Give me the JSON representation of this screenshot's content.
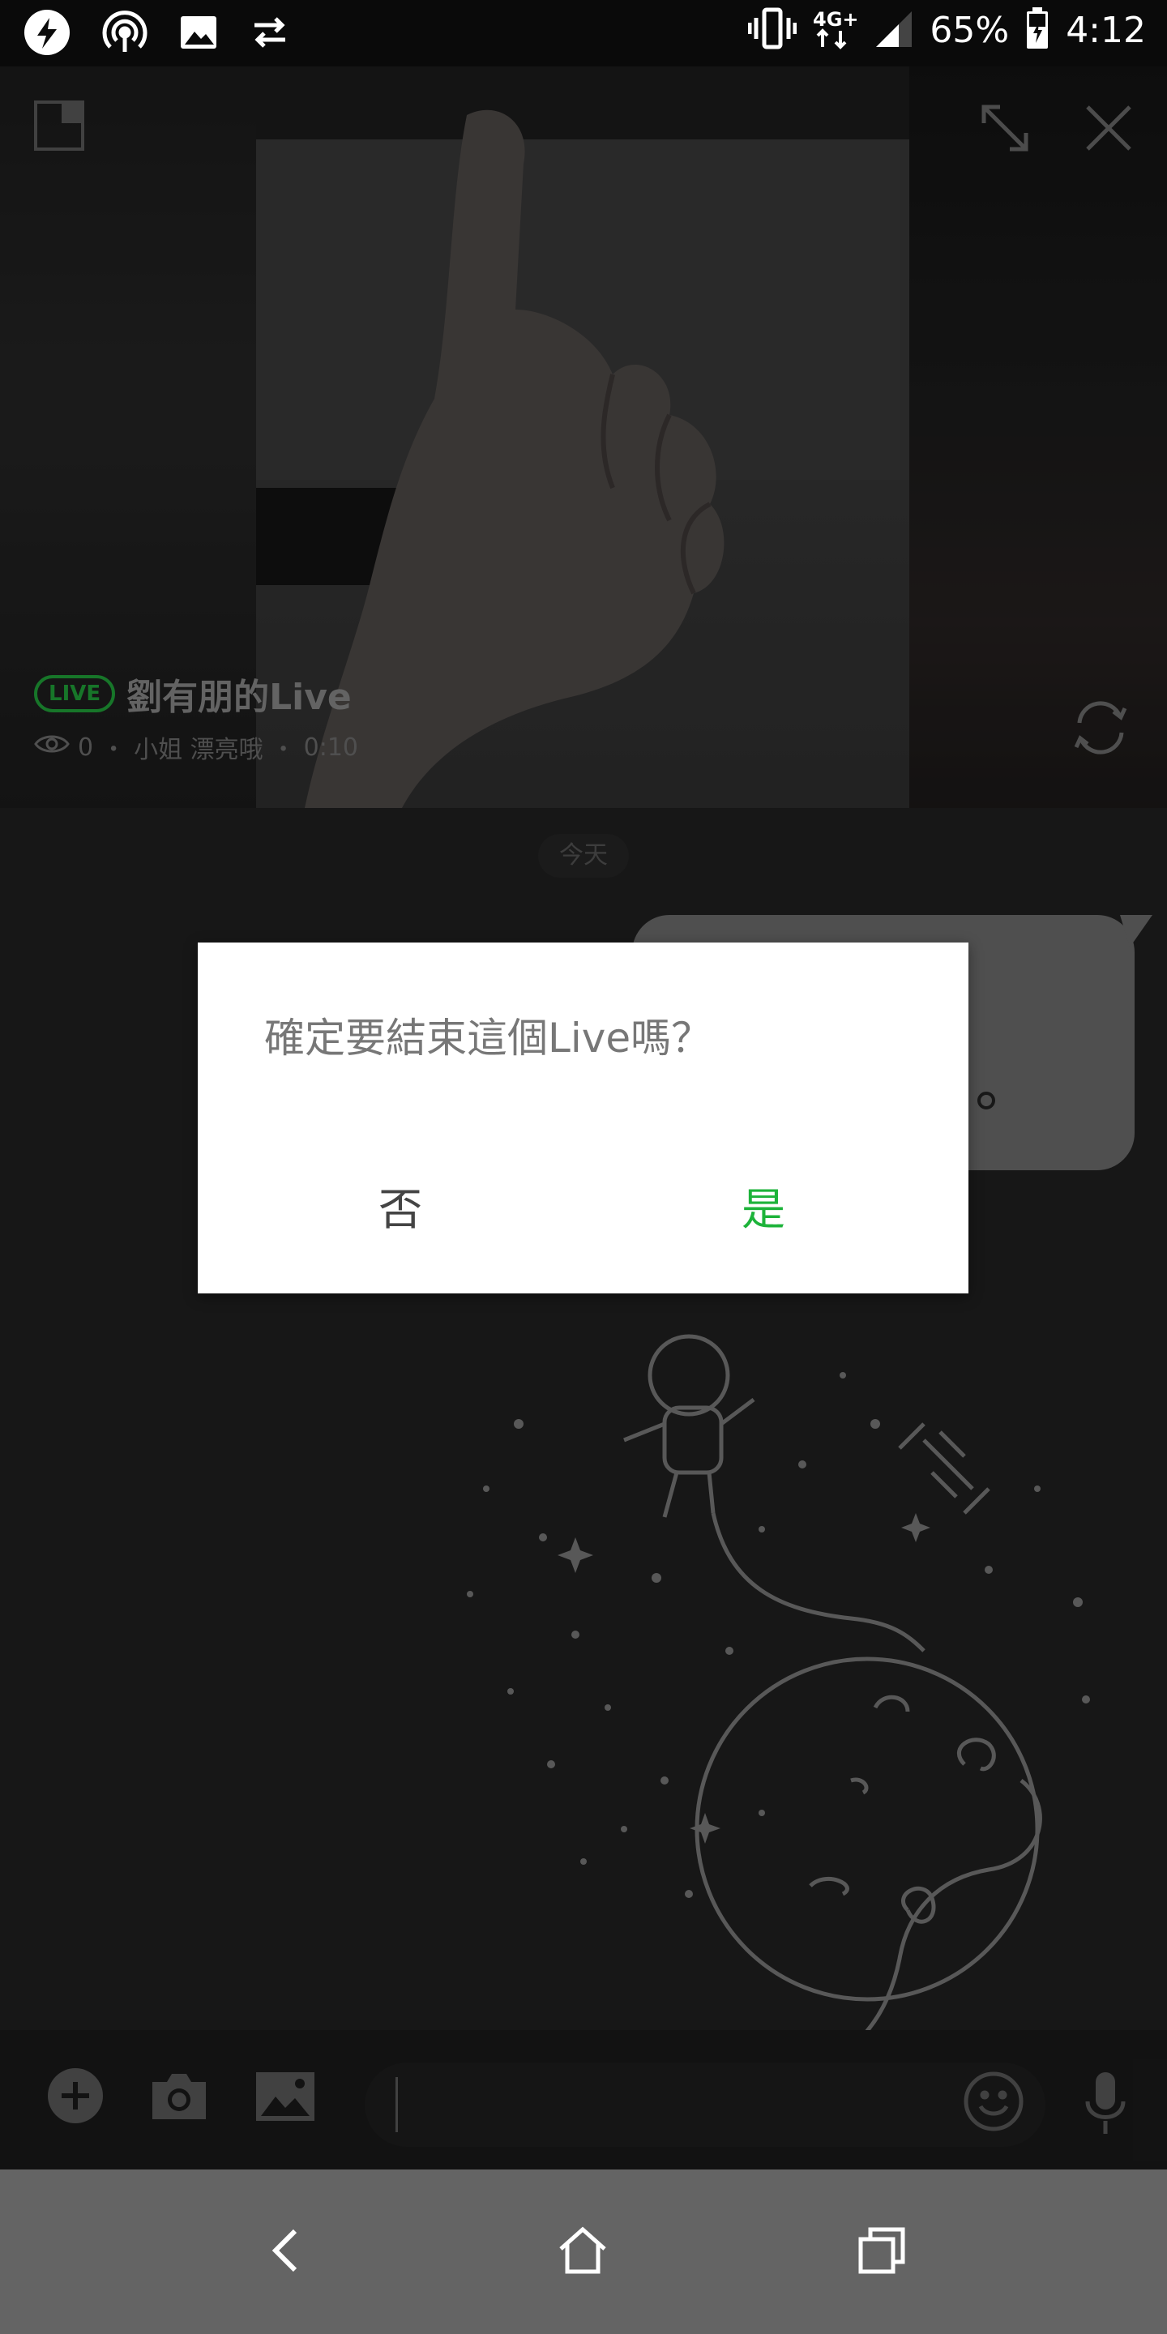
{
  "status_bar": {
    "battery_percent": "65%",
    "time": "4:12",
    "network": "4G+"
  },
  "live": {
    "badge": "LIVE",
    "title": "劉有朋的Live",
    "viewers": "0",
    "subtitle": "小姐 漂亮哦",
    "duration": "0:10",
    "separator": "・"
  },
  "chat": {
    "date_label": "今天"
  },
  "dialog": {
    "message": "確定要結束這個Live嗎？",
    "no_label": "否",
    "yes_label": "是"
  },
  "colors": {
    "accent_green": "#1db33a",
    "live_badge_green": "#20a43a"
  },
  "icons": {
    "status_left": [
      "messenger-icon",
      "hotspot-icon",
      "gallery-icon",
      "sync-icon"
    ],
    "status_right": [
      "vibrate-icon",
      "network-icon",
      "signal-icon",
      "battery-icon"
    ],
    "video_controls": [
      "minimize-icon",
      "expand-icon",
      "close-icon",
      "switch-camera-icon"
    ],
    "composer": [
      "add-icon",
      "camera-icon",
      "image-icon",
      "emoji-icon",
      "mic-icon"
    ],
    "nav": [
      "back-icon",
      "home-icon",
      "recents-icon"
    ]
  }
}
